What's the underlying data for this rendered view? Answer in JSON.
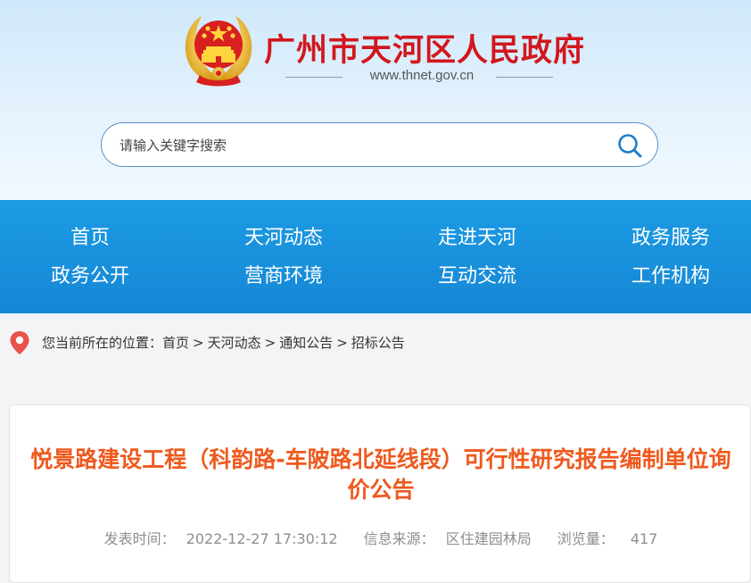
{
  "header": {
    "site_title": "广州市天河区人民政府",
    "site_url": "www.thnet.gov.cn",
    "emblem_icon": "national-emblem-icon",
    "colors": {
      "title": "#d2171d",
      "bg_top": "#cfe8fb"
    }
  },
  "search": {
    "placeholder": "请输入关键字搜索",
    "icon": "search-icon"
  },
  "nav": {
    "items": [
      {
        "label": "首页"
      },
      {
        "label": "天河动态"
      },
      {
        "label": "走进天河"
      },
      {
        "label": "政务服务"
      },
      {
        "label": "政务公开"
      },
      {
        "label": "营商环境"
      },
      {
        "label": "互动交流"
      },
      {
        "label": "工作机构"
      }
    ],
    "color": "#1c9be3"
  },
  "breadcrumb": {
    "icon": "location-pin-icon",
    "label": "您当前所在的位置：",
    "items": [
      "首页",
      "天河动态",
      "通知公告",
      "招标公告"
    ],
    "separator": ">"
  },
  "article": {
    "title": "悦景路建设工程（科韵路-车陂路北延线段）可行性研究报告编制单位询价公告",
    "meta": {
      "publish_label": "发表时间：",
      "publish_time": "2022-12-27 17:30:12",
      "source_label": "信息来源：",
      "source": "区住建园林局",
      "views_label": "浏览量：",
      "views": "417"
    },
    "title_color": "#ee5a1e"
  }
}
